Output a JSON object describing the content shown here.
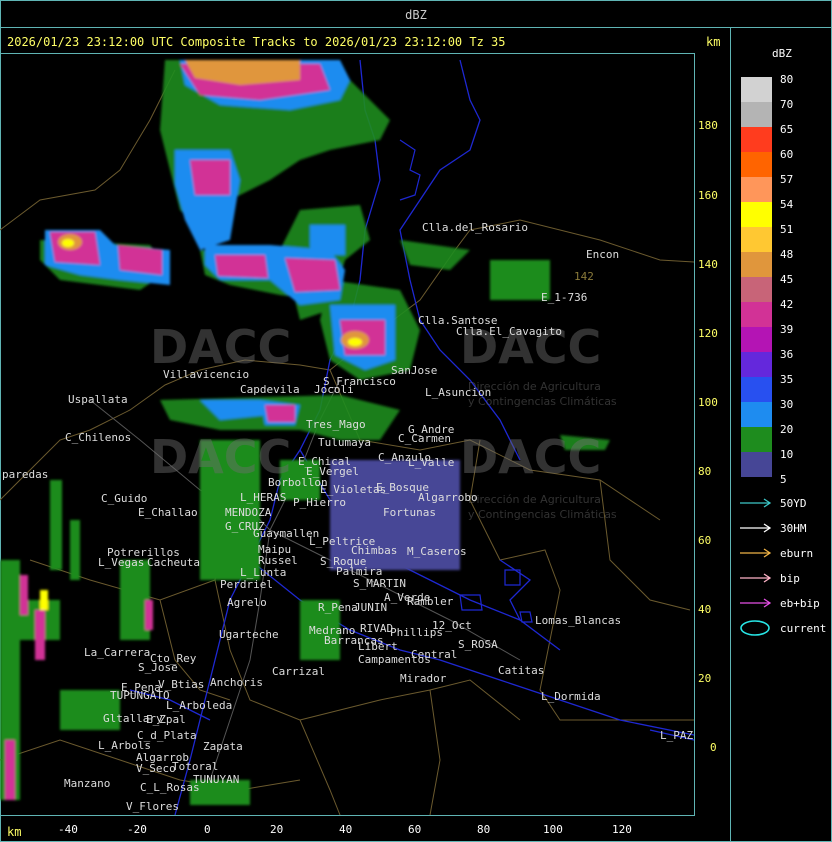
{
  "window": {
    "title": "dBZ"
  },
  "status_line": "2026/01/23 23:12:00 UTC Composite Tracks to 2026/01/23 23:12:00 Tz 35",
  "axes": {
    "unit_top": "km",
    "unit_bottom": "km",
    "y_ticks": [
      "180",
      "160",
      "140",
      "120",
      "100",
      "80",
      "60",
      "40",
      "20",
      "0"
    ],
    "x_ticks": [
      "-40",
      "-20",
      "0",
      "20",
      "40",
      "60",
      "80",
      "100",
      "120"
    ]
  },
  "legend": {
    "title": "dBZ",
    "levels": [
      {
        "label": "80",
        "color": "#d2d2d2"
      },
      {
        "label": "70",
        "color": "#b4b4b4"
      },
      {
        "label": "65",
        "color": "#ff3c1e"
      },
      {
        "label": "60",
        "color": "#ff6400"
      },
      {
        "label": "57",
        "color": "#ff965a"
      },
      {
        "label": "54",
        "color": "#ffff00"
      },
      {
        "label": "51",
        "color": "#ffc832"
      },
      {
        "label": "48",
        "color": "#e0963c"
      },
      {
        "label": "45",
        "color": "#c86478"
      },
      {
        "label": "42",
        "color": "#d23296"
      },
      {
        "label": "39",
        "color": "#b414b4"
      },
      {
        "label": "36",
        "color": "#6428dc"
      },
      {
        "label": "35",
        "color": "#2850f0"
      },
      {
        "label": "30",
        "color": "#1e8cf0"
      },
      {
        "label": "20",
        "color": "#1e8c1e"
      },
      {
        "label": "10",
        "color": "#006400"
      },
      {
        "label": "5",
        "color": "#464696"
      }
    ],
    "tracks": [
      {
        "label": "50YD",
        "color": "#3cc8c8"
      },
      {
        "label": "30HM",
        "color": "#ffffff"
      },
      {
        "label": "eburn",
        "color": "#f0b446"
      },
      {
        "label": "bip",
        "color": "#ffb4c8"
      },
      {
        "label": "eb+bip",
        "color": "#e650e6"
      },
      {
        "label": "current",
        "color": "#28e6e6"
      }
    ]
  },
  "places": [
    "Clla.del_Rosario",
    "Encon",
    "E_1-736",
    "Clla.Santose",
    "Clla.El_Cavagito",
    "Villavicencio",
    "Capdevila",
    "S_Francisco",
    "SanJose",
    "L_Asuncion",
    "Uspallata",
    "C_Chilenos",
    "Jocoli",
    "Tres_Mago",
    "G_Andre",
    "C_Carmen",
    "Tulumaya",
    "E_Chical",
    "E_Vergel",
    "Borbollon",
    "C_Anzulo",
    "L_Valle",
    "E_Violetas",
    "E_Bosque",
    "Algarrobo",
    "paredas",
    "L_HERAS",
    "P_Hierro",
    "C_Guido",
    "E_Challao",
    "MENDOZA",
    "G_CRUZ",
    "Fortunas",
    "Guaymallen",
    "Potrerillos",
    "Cacheuta",
    "L_Vegas",
    "L_Peltrice",
    "Chimbas",
    "M_Caseros",
    "Maipu",
    "Russel",
    "S_Roque",
    "L_Lunta",
    "Perdriel",
    "Palmira",
    "S_MARTIN",
    "A_Verde",
    "Rambler",
    "Agrelo",
    "R_Pena",
    "JUNIN",
    "Ugarteche",
    "Medrano",
    "Lomas_Blancas",
    "RIVAD",
    "Phillips",
    "12_Oct",
    "S_ROSA",
    "Barrancas",
    "Libert",
    "Campamentos",
    "Central",
    "La_Carrera",
    "Cto_Rey",
    "S_Jose",
    "Anchoris",
    "Carrizal",
    "Catitas",
    "E_Pena",
    "V_Btias",
    "TUPUNGATO",
    "Mirador",
    "L_Dormida",
    "E_Zpal",
    "L_Arboleda",
    "Gltallary",
    "C_d_Plata",
    "L_Arbols",
    "Zapata",
    "Algarrob",
    "V_Seco",
    "Totoral",
    "TUNUYAN",
    "Manzano",
    "C_L_Rosas",
    "V_Flores",
    "L_PAZ",
    "142"
  ],
  "watermark": {
    "brand": "DACC",
    "line1": "Dirección de Agricultura",
    "line2": "y Contingencias Climáticas"
  }
}
